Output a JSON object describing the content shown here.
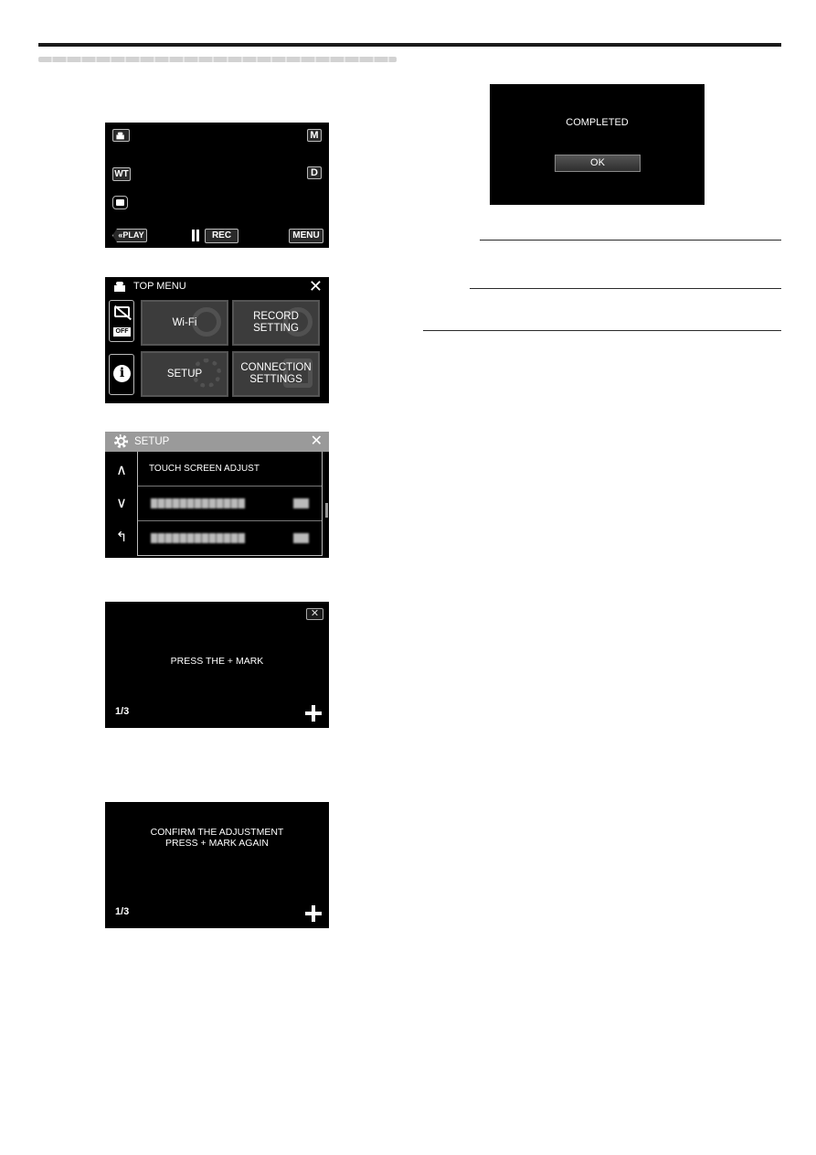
{
  "screens": {
    "record": {
      "mode_icon": "video-camera-icon",
      "manual_button": "M",
      "wt_button": "WT",
      "display_button": "D",
      "snapshot_icon": "camera-icon",
      "play_button": "«PLAY",
      "pause_icon": "pause-icon",
      "rec_button": "REC",
      "menu_button": "MENU"
    },
    "top_menu": {
      "title": "TOP MENU",
      "title_icon": "video-camera-icon",
      "close_label": "✕",
      "silent_mode_badge": "OFF",
      "silent_mode_icon": "silent-mode-icon",
      "info_icon_glyph": "i",
      "tiles": [
        {
          "label_line1": "Wi-Fi",
          "label_line2": "",
          "bg_icon": "wifi-icon"
        },
        {
          "label_line1": "RECORD",
          "label_line2": "SETTING",
          "bg_icon": "record-icon"
        },
        {
          "label_line1": "SETUP",
          "label_line2": "",
          "bg_icon": "gear-icon"
        },
        {
          "label_line1": "CONNECTION",
          "label_line2": "SETTINGS",
          "bg_icon": "connection-icon"
        }
      ]
    },
    "setup": {
      "title": "SETUP",
      "close_label": "✕",
      "up_arrow": "∧",
      "down_arrow": "∨",
      "back_arrow": "↰",
      "items": [
        {
          "label": "TOUCH SCREEN ADJUST"
        },
        {
          "label": "",
          "blurred": true
        },
        {
          "label": "",
          "blurred": true
        }
      ]
    },
    "adjust_step1": {
      "close_label": "✕",
      "message": "PRESS THE + MARK",
      "page": "1/3"
    },
    "adjust_confirm": {
      "message_line1": "CONFIRM THE ADJUSTMENT",
      "message_line2": "PRESS + MARK AGAIN",
      "page": "1/3"
    },
    "completed": {
      "message": "COMPLETED",
      "ok_button": "OK"
    }
  }
}
